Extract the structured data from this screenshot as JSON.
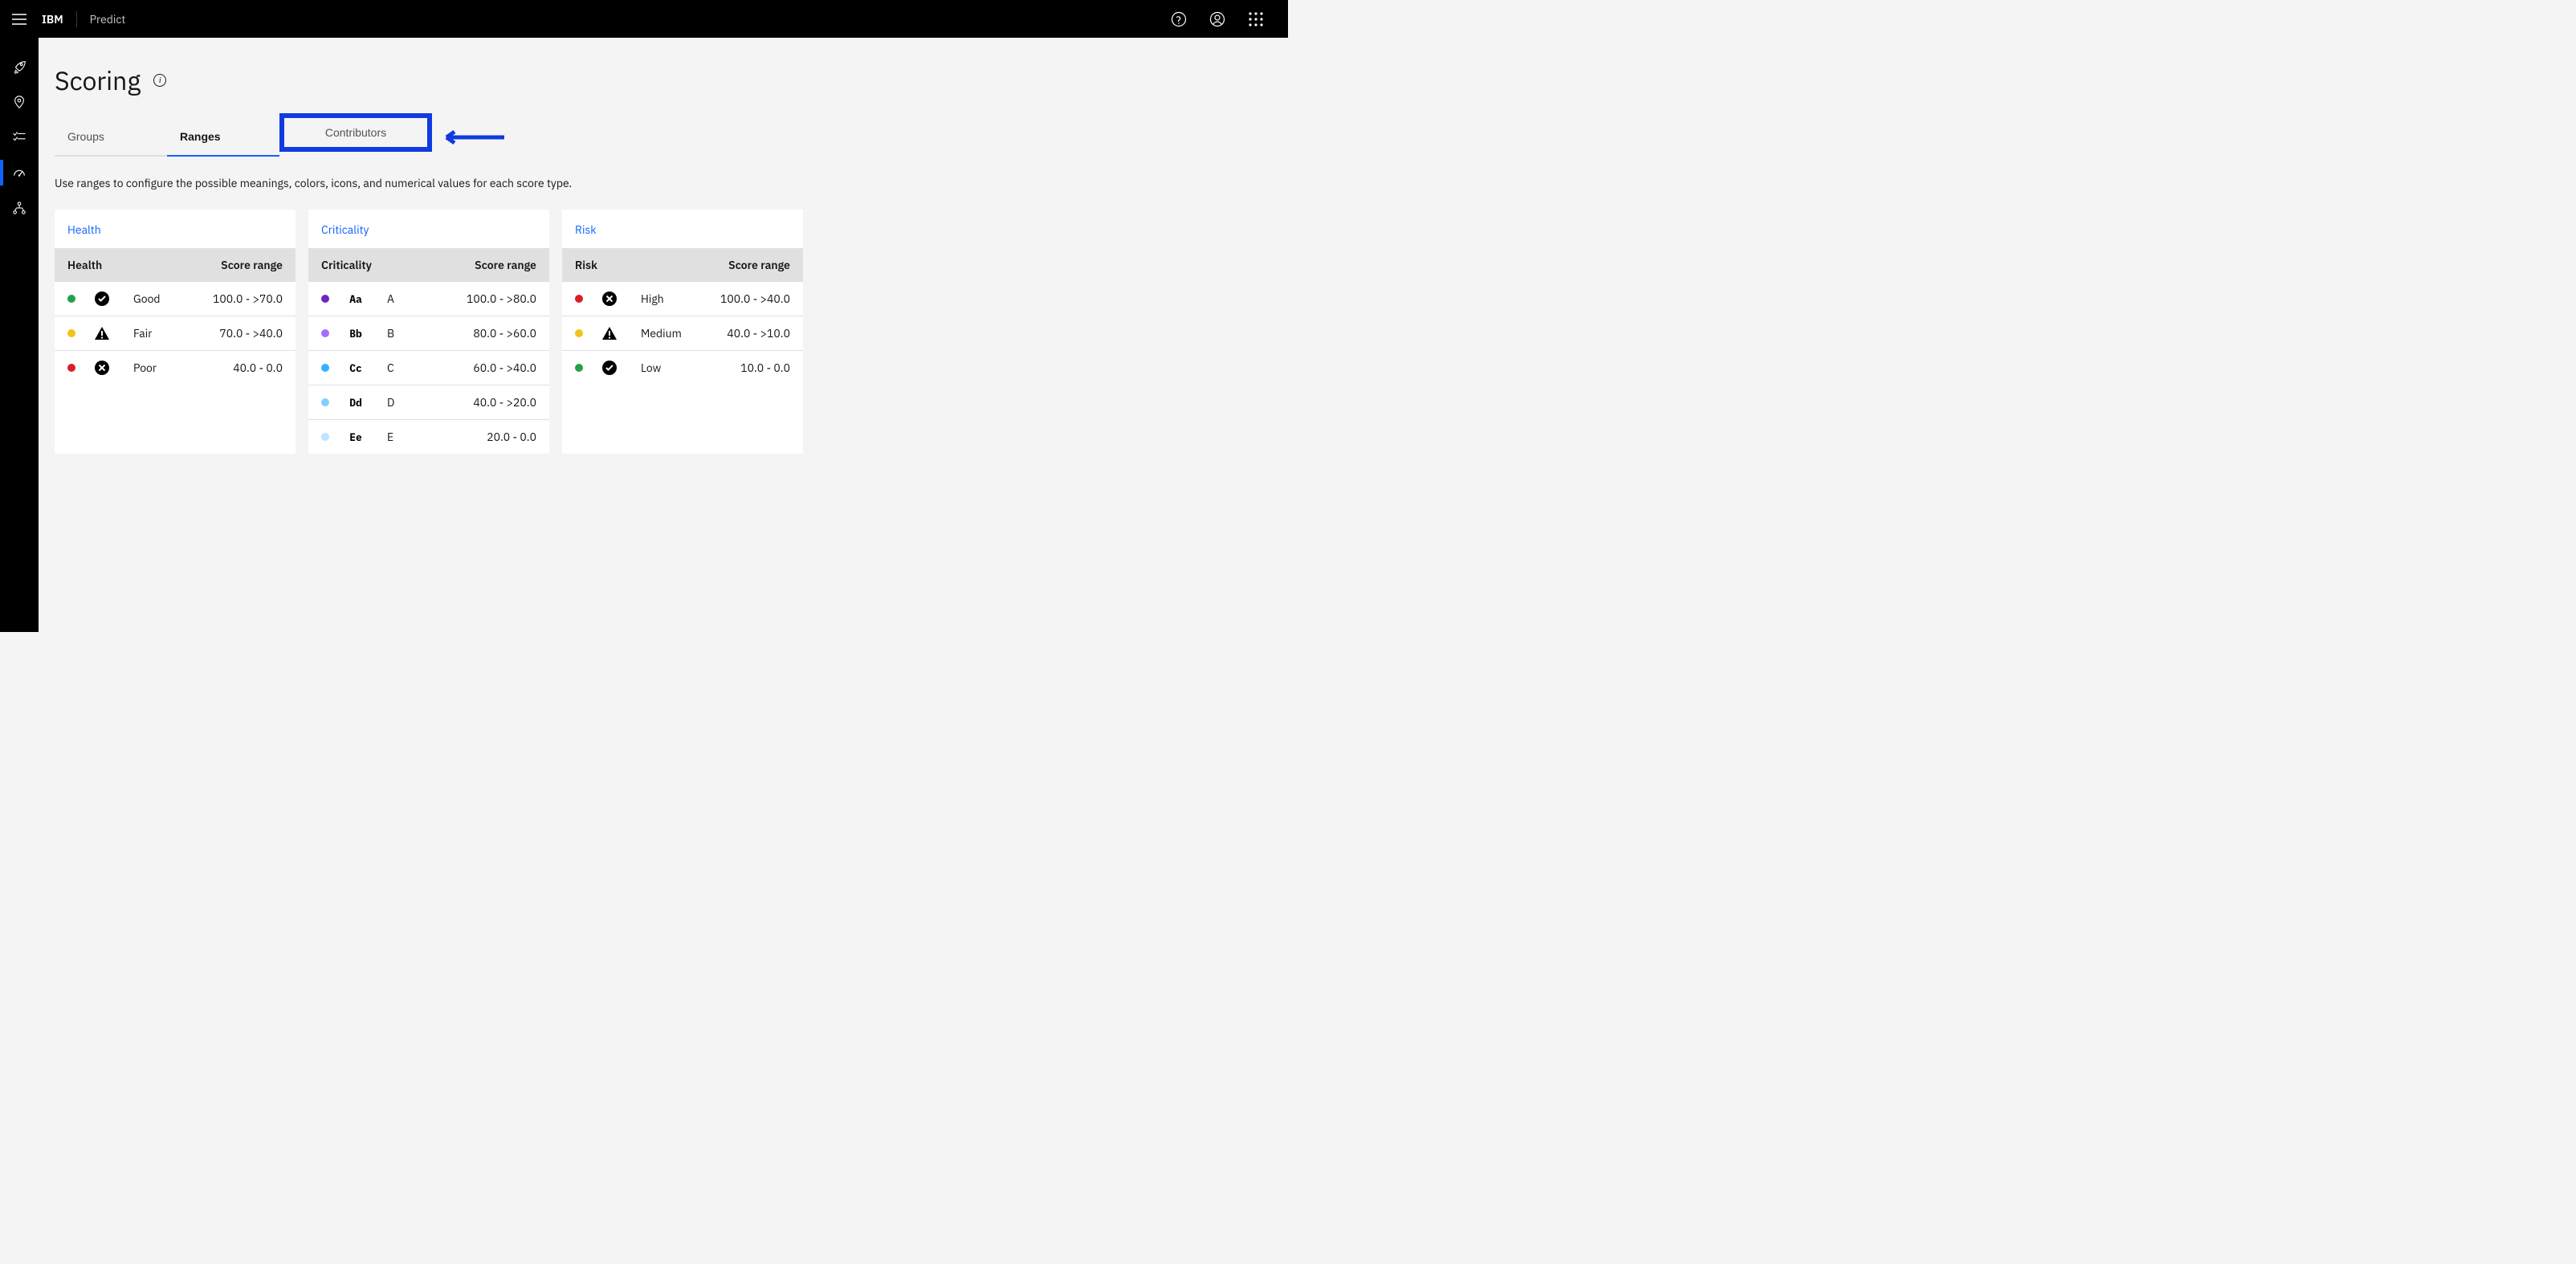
{
  "header": {
    "brand": "IBM",
    "product": "Predict"
  },
  "page": {
    "title": "Scoring",
    "info_glyph": "i",
    "description": "Use ranges to configure the possible meanings, colors, icons, and numerical values for each score type."
  },
  "tabs": {
    "groups": "Groups",
    "ranges": "Ranges",
    "contributors": "Contributors"
  },
  "cards": {
    "health": {
      "title": "Health",
      "head_name": "Health",
      "head_range": "Score range",
      "rows": [
        {
          "dot": "#24a148",
          "icon": "check",
          "label": "Good",
          "range": "100.0 - >70.0"
        },
        {
          "dot": "#f1c21b",
          "icon": "warn",
          "label": "Fair",
          "range": "70.0 - >40.0"
        },
        {
          "dot": "#da1e28",
          "icon": "cross",
          "label": "Poor",
          "range": "40.0 - 0.0"
        }
      ]
    },
    "criticality": {
      "title": "Criticality",
      "head_name": "Criticality",
      "head_range": "Score range",
      "rows": [
        {
          "dot": "#6929c4",
          "icon": "Aa",
          "label": "A",
          "range": "100.0 - >80.0"
        },
        {
          "dot": "#a56eff",
          "icon": "Bb",
          "label": "B",
          "range": "80.0 - >60.0"
        },
        {
          "dot": "#33b1ff",
          "icon": "Cc",
          "label": "C",
          "range": "60.0 - >40.0"
        },
        {
          "dot": "#82cfff",
          "icon": "Dd",
          "label": "D",
          "range": "40.0 - >20.0"
        },
        {
          "dot": "#bae6ff",
          "icon": "Ee",
          "label": "E",
          "range": "20.0 - 0.0"
        }
      ]
    },
    "risk": {
      "title": "Risk",
      "head_name": "Risk",
      "head_range": "Score range",
      "rows": [
        {
          "dot": "#da1e28",
          "icon": "cross",
          "label": "High",
          "range": "100.0 - >40.0"
        },
        {
          "dot": "#f1c21b",
          "icon": "warn",
          "label": "Medium",
          "range": "40.0 - >10.0"
        },
        {
          "dot": "#24a148",
          "icon": "check",
          "label": "Low",
          "range": "10.0 - 0.0"
        }
      ]
    }
  }
}
